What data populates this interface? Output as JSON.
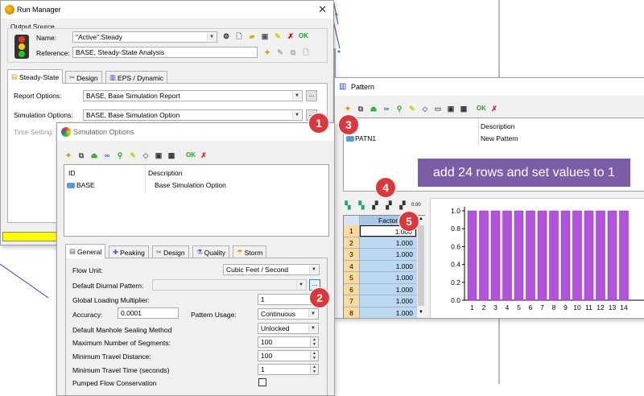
{
  "run_manager": {
    "title": "Run Manager",
    "output_source_label": "Output Source",
    "name_label": "Name:",
    "name_value": "\"Active\":Steady",
    "reference_label": "Reference:",
    "reference_value": "BASE, Steady-State Analysis",
    "ok_label": "OK",
    "tabs": [
      {
        "label": "Steady-State",
        "icon": "steady-state-icon"
      },
      {
        "label": "Design",
        "icon": "design-icon"
      },
      {
        "label": "EPS / Dynamic",
        "icon": "chart-icon"
      }
    ],
    "report_options_label": "Report Options:",
    "report_options_value": "BASE, Base Simulation Report",
    "simulation_options_label": "Simulation Options:",
    "simulation_options_value": "BASE, Base Simulation Option",
    "time_setting_label": "Time Setting:",
    "ellipsis": "..."
  },
  "simulation_options": {
    "title": "Simulation Options",
    "ok_label": "OK",
    "col_id": "ID",
    "col_description": "Description",
    "rows": [
      {
        "id": "BASE",
        "description": "Base Simulation Option"
      }
    ],
    "tabs": [
      {
        "label": "General"
      },
      {
        "label": "Peaking"
      },
      {
        "label": "Design"
      },
      {
        "label": "Quality"
      },
      {
        "label": "Storm"
      }
    ],
    "flow_unit_label": "Flow Unit:",
    "flow_unit_value": "Cubic Feet / Second",
    "diurnal_label": "Default Diurnal Pattern:",
    "diurnal_value": "",
    "glm_label": "Global Loading Multiplier:",
    "glm_value": "1",
    "accuracy_label": "Accuracy:",
    "accuracy_value": "0.0001",
    "pattern_usage_label": "Pattern Usage:",
    "pattern_usage_value": "Continuous",
    "manhole_label": "Default Manhole Sealing Method",
    "manhole_value": "Unlocked",
    "max_segments_label": "Maximum Number of Segments:",
    "max_segments_value": "100",
    "min_travel_distance_label": "Minimum Travel Distance:",
    "min_travel_distance_value": "100",
    "min_travel_time_label": "Minimum Travel Time (seconds)",
    "min_travel_time_value": "1",
    "pumped_flow_label": "Pumped Flow Conservation",
    "ellipsis": "..."
  },
  "pattern": {
    "title": "Pattern",
    "ok_label": "OK",
    "col_description": "Description",
    "rows": [
      {
        "id": "PATN1",
        "description": "New Pattern"
      }
    ],
    "callout": "add 24 rows and set values to 1",
    "factor_header": "Factor",
    "factors": [
      {
        "n": "1",
        "v": "1.000"
      },
      {
        "n": "2",
        "v": "1.000"
      },
      {
        "n": "3",
        "v": "1.000"
      },
      {
        "n": "4",
        "v": "1.000"
      },
      {
        "n": "5",
        "v": "1.000"
      },
      {
        "n": "6",
        "v": "1.000"
      },
      {
        "n": "7",
        "v": "1.000"
      },
      {
        "n": "8",
        "v": "1.000"
      }
    ],
    "grid_toolbar_last": "0.00"
  },
  "chart_data": {
    "type": "bar",
    "categories": [
      "1",
      "2",
      "3",
      "4",
      "5",
      "6",
      "7",
      "8",
      "9",
      "10",
      "11",
      "12",
      "13",
      "14"
    ],
    "values": [
      1,
      1,
      1,
      1,
      1,
      1,
      1,
      1,
      1,
      1,
      1,
      1,
      1,
      1
    ],
    "ylim": [
      0,
      1
    ],
    "yticks": [
      "1.0",
      "0.8",
      "0.6",
      "0.4",
      "0.2",
      "0.0"
    ],
    "bar_color": "#b452e0"
  },
  "badges": [
    "1",
    "2",
    "3",
    "4",
    "5"
  ],
  "colors": {
    "accent_blue": "#5b9bd5",
    "badge_red": "#d9383c",
    "callout_purple": "#7b5ea7",
    "progress_yellow": "#ffff00",
    "ok_green": "#2a9d2a"
  }
}
